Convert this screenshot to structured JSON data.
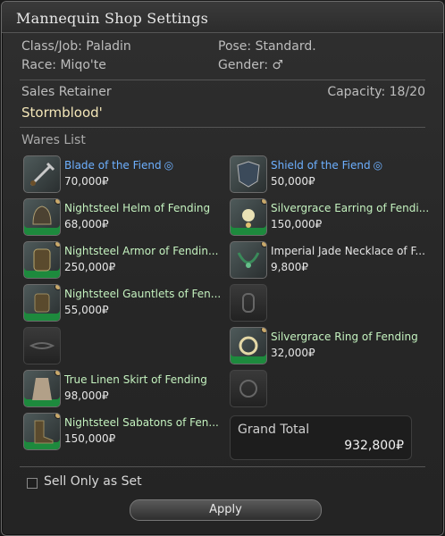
{
  "window": {
    "title": "Mannequin Shop Settings"
  },
  "info": {
    "class_job": "Class/Job: Paladin",
    "pose": "Pose: Standard.",
    "race": "Race: Miqo'te",
    "gender": "Gender: ♂"
  },
  "retainer": {
    "label": "Sales Retainer",
    "capacity": "Capacity: 18/20",
    "name": "Stormblood'"
  },
  "wares": {
    "label": "Wares List",
    "left": [
      {
        "name": "Blade of the Fiend",
        "price": "70,000₽",
        "color": "blue",
        "icon": "sword-icon",
        "has_item": true,
        "hq": true
      },
      {
        "name": "Nightsteel Helm of Fending",
        "price": "68,000₽",
        "color": "green",
        "icon": "helm-icon",
        "has_item": true
      },
      {
        "name": "Nightsteel Armor of Fendin...",
        "price": "250,000₽",
        "color": "green",
        "icon": "armor-icon",
        "has_item": true
      },
      {
        "name": "Nightsteel Gauntlets of Fen...",
        "price": "55,000₽",
        "color": "green",
        "icon": "gauntlet-icon",
        "has_item": true
      },
      {
        "name": "",
        "price": "",
        "color": "",
        "icon": "belt-slot-icon",
        "has_item": false
      },
      {
        "name": "True Linen Skirt of Fending",
        "price": "98,000₽",
        "color": "green",
        "icon": "skirt-icon",
        "has_item": true
      },
      {
        "name": "Nightsteel Sabatons of Fen...",
        "price": "150,000₽",
        "color": "green",
        "icon": "sabatons-icon",
        "has_item": true
      }
    ],
    "right": [
      {
        "name": "Shield of the Fiend",
        "price": "50,000₽",
        "color": "blue",
        "icon": "shield-icon",
        "has_item": true,
        "hq": true
      },
      {
        "name": "Silvergrace Earring of Fendi...",
        "price": "150,000₽",
        "color": "green",
        "icon": "earring-icon",
        "has_item": true
      },
      {
        "name": "Imperial Jade Necklace of F...",
        "price": "9,800₽",
        "color": "white",
        "icon": "necklace-icon",
        "has_item": true
      },
      {
        "name": "",
        "price": "",
        "color": "",
        "icon": "bracelet-slot-icon",
        "has_item": false
      },
      {
        "name": "Silvergrace Ring of Fending",
        "price": "32,000₽",
        "color": "green",
        "icon": "ring-icon",
        "has_item": true
      },
      {
        "name": "",
        "price": "",
        "color": "",
        "icon": "ring-slot-icon",
        "has_item": false
      }
    ]
  },
  "grand_total": {
    "label": "Grand Total",
    "value": "932,800₽"
  },
  "sell_only_as_set": {
    "label": "Sell Only as Set",
    "checked": false
  },
  "apply_button": {
    "label": "Apply"
  },
  "colors": {
    "blue_text": "#6db0ff",
    "green_text": "#c4f2bf",
    "gold_text": "#f3e6b8",
    "hq_glyph": "#6db0ff"
  }
}
